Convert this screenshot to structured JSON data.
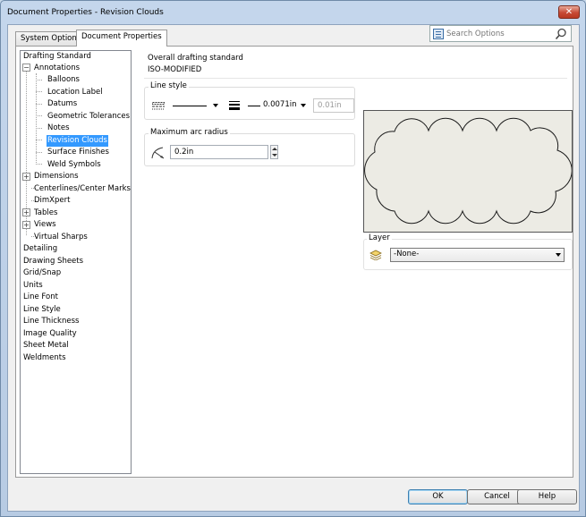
{
  "window": {
    "title": "Document Properties - Revision Clouds",
    "close_glyph": "✕"
  },
  "tabs": [
    {
      "label": "System Options",
      "active": false
    },
    {
      "label": "Document Properties",
      "active": true
    }
  ],
  "search": {
    "placeholder": "Search Options"
  },
  "tree": {
    "items": [
      {
        "label": "Drafting Standard",
        "level": 0,
        "expander": ""
      },
      {
        "label": "Annotations",
        "level": 1,
        "expander": "minus"
      },
      {
        "label": "Balloons",
        "level": 2,
        "expander": ""
      },
      {
        "label": "Location Label",
        "level": 2,
        "expander": ""
      },
      {
        "label": "Datums",
        "level": 2,
        "expander": ""
      },
      {
        "label": "Geometric Tolerances",
        "level": 2,
        "expander": ""
      },
      {
        "label": "Notes",
        "level": 2,
        "expander": ""
      },
      {
        "label": "Revision Clouds",
        "level": 2,
        "expander": "",
        "selected": true
      },
      {
        "label": "Surface Finishes",
        "level": 2,
        "expander": ""
      },
      {
        "label": "Weld Symbols",
        "level": 2,
        "expander": ""
      },
      {
        "label": "Dimensions",
        "level": 1,
        "expander": "plus"
      },
      {
        "label": "Centerlines/Center Marks",
        "level": 1,
        "expander": ""
      },
      {
        "label": "DimXpert",
        "level": 1,
        "expander": ""
      },
      {
        "label": "Tables",
        "level": 1,
        "expander": "plus"
      },
      {
        "label": "Views",
        "level": 1,
        "expander": "plus"
      },
      {
        "label": "Virtual Sharps",
        "level": 1,
        "expander": ""
      },
      {
        "label": "Detailing",
        "level": 0,
        "expander": ""
      },
      {
        "label": "Drawing Sheets",
        "level": 0,
        "expander": ""
      },
      {
        "label": "Grid/Snap",
        "level": 0,
        "expander": ""
      },
      {
        "label": "Units",
        "level": 0,
        "expander": ""
      },
      {
        "label": "Line Font",
        "level": 0,
        "expander": ""
      },
      {
        "label": "Line Style",
        "level": 0,
        "expander": ""
      },
      {
        "label": "Line Thickness",
        "level": 0,
        "expander": ""
      },
      {
        "label": "Image Quality",
        "level": 0,
        "expander": ""
      },
      {
        "label": "Sheet Metal",
        "level": 0,
        "expander": ""
      },
      {
        "label": "Weldments",
        "level": 0,
        "expander": ""
      }
    ]
  },
  "drafting_standard": {
    "label": "Overall drafting standard",
    "value": "ISO-MODIFIED"
  },
  "line_style": {
    "title": "Line style",
    "thickness_value": "0.0071in",
    "custom_thickness": "0.01in"
  },
  "arc_radius": {
    "title": "Maximum arc radius",
    "value": "0.2in"
  },
  "layer": {
    "title": "Layer",
    "value": "-None-"
  },
  "buttons": {
    "ok": "OK",
    "cancel": "Cancel",
    "help": "Help"
  }
}
